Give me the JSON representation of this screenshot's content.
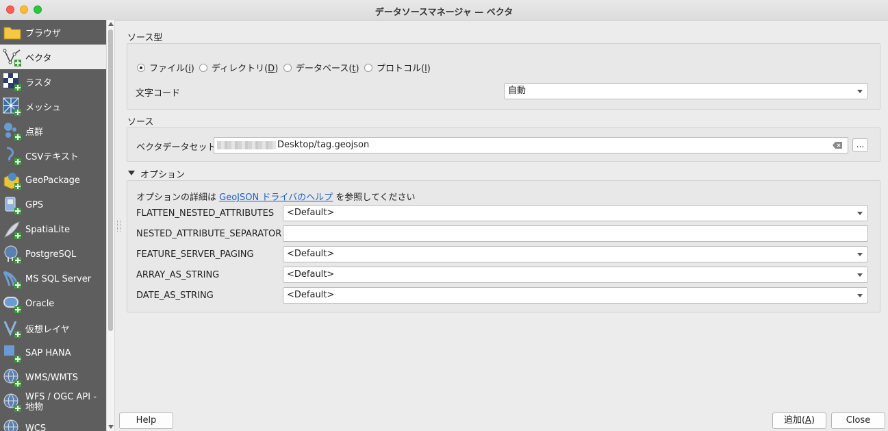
{
  "window": {
    "title": "データソースマネージャ — ベクタ"
  },
  "sidebar": {
    "items": [
      {
        "label": "ブラウザ",
        "icon": "folder-icon"
      },
      {
        "label": "ベクタ",
        "icon": "vector-add-icon"
      },
      {
        "label": "ラスタ",
        "icon": "raster-add-icon"
      },
      {
        "label": "メッシュ",
        "icon": "mesh-add-icon"
      },
      {
        "label": "点群",
        "icon": "pointcloud-add-icon"
      },
      {
        "label": "CSVテキスト",
        "icon": "csv-add-icon"
      },
      {
        "label": "GeoPackage",
        "icon": "geopackage-add-icon"
      },
      {
        "label": "GPS",
        "icon": "gps-add-icon"
      },
      {
        "label": "SpatiaLite",
        "icon": "spatialite-add-icon"
      },
      {
        "label": "PostgreSQL",
        "icon": "postgresql-add-icon"
      },
      {
        "label": "MS SQL Server",
        "icon": "mssql-add-icon"
      },
      {
        "label": "Oracle",
        "icon": "oracle-add-icon"
      },
      {
        "label": "仮想レイヤ",
        "icon": "virtual-layer-add-icon"
      },
      {
        "label": "SAP HANA",
        "icon": "saphana-add-icon"
      },
      {
        "label": "WMS/WMTS",
        "icon": "wms-add-icon"
      },
      {
        "label": "WFS / OGC API -",
        "label2": "地物",
        "icon": "wfs-add-icon"
      },
      {
        "label": "WCS",
        "icon": "wcs-add-icon"
      }
    ]
  },
  "source_type": {
    "heading": "ソース型",
    "options": [
      {
        "label": "ファイル(",
        "mnemonic": "i",
        "suffix": ")"
      },
      {
        "label": "ディレクトリ(",
        "mnemonic": "D",
        "suffix": ")"
      },
      {
        "label": "データベース(",
        "mnemonic": "t",
        "suffix": ")"
      },
      {
        "label": "プロトコル(",
        "mnemonic": "l",
        "suffix": ")"
      }
    ],
    "selected": "ファイル(i)",
    "encoding_label": "文字コード",
    "encoding_value": "自動"
  },
  "source": {
    "heading": "ソース",
    "dataset_label": "ベクタデータセット",
    "dataset_value": "Desktop/tag.geojson",
    "browse_label": "..."
  },
  "options": {
    "heading": "オプション",
    "help_prefix": "オプションの詳細は ",
    "help_link": "GeoJSON ドライバのヘルプ",
    "help_suffix": " を参照してください",
    "rows": [
      {
        "label": "FLATTEN_NESTED_ATTRIBUTES",
        "value": "<Default>",
        "type": "combo"
      },
      {
        "label": "NESTED_ATTRIBUTE_SEPARATOR",
        "value": "",
        "type": "text"
      },
      {
        "label": "FEATURE_SERVER_PAGING",
        "value": "<Default>",
        "type": "combo"
      },
      {
        "label": "ARRAY_AS_STRING",
        "value": "<Default>",
        "type": "combo"
      },
      {
        "label": "DATE_AS_STRING",
        "value": "<Default>",
        "type": "combo"
      }
    ]
  },
  "buttons": {
    "help": "Help",
    "add": "追加(",
    "add_mnemonic": "A",
    "add_suffix": ")",
    "close": "Close"
  }
}
